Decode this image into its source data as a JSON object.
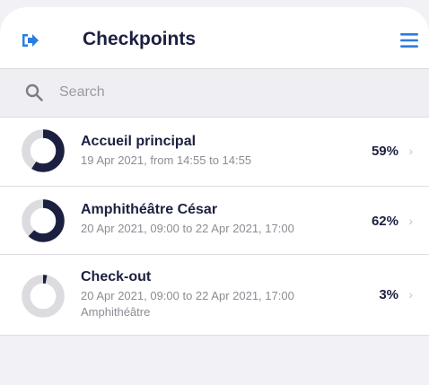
{
  "header": {
    "title": "Checkpoints",
    "logout_icon": "logout-icon",
    "menu_icon": "hamburger-menu-icon",
    "accent_color": "#2a7de1"
  },
  "search": {
    "placeholder": "Search",
    "value": "",
    "icon": "search-icon"
  },
  "checkpoints": [
    {
      "name": "Accueil principal",
      "schedule": "19 Apr 2021, from 14:55 to 14:55",
      "location": "",
      "percent_label": "59%",
      "progress": 0.59
    },
    {
      "name": "Amphithéâtre César",
      "schedule": "20 Apr 2021, 09:00 to 22 Apr 2021, 17:00",
      "location": "",
      "percent_label": "62%",
      "progress": 0.62
    },
    {
      "name": "Check-out",
      "schedule": "20 Apr 2021, 09:00 to 22 Apr 2021, 17:00",
      "location": "Amphithéâtre",
      "percent_label": "3%",
      "progress": 0.03
    }
  ],
  "colors": {
    "progress_fill": "#1c2040",
    "progress_track": "#dcdce0"
  }
}
